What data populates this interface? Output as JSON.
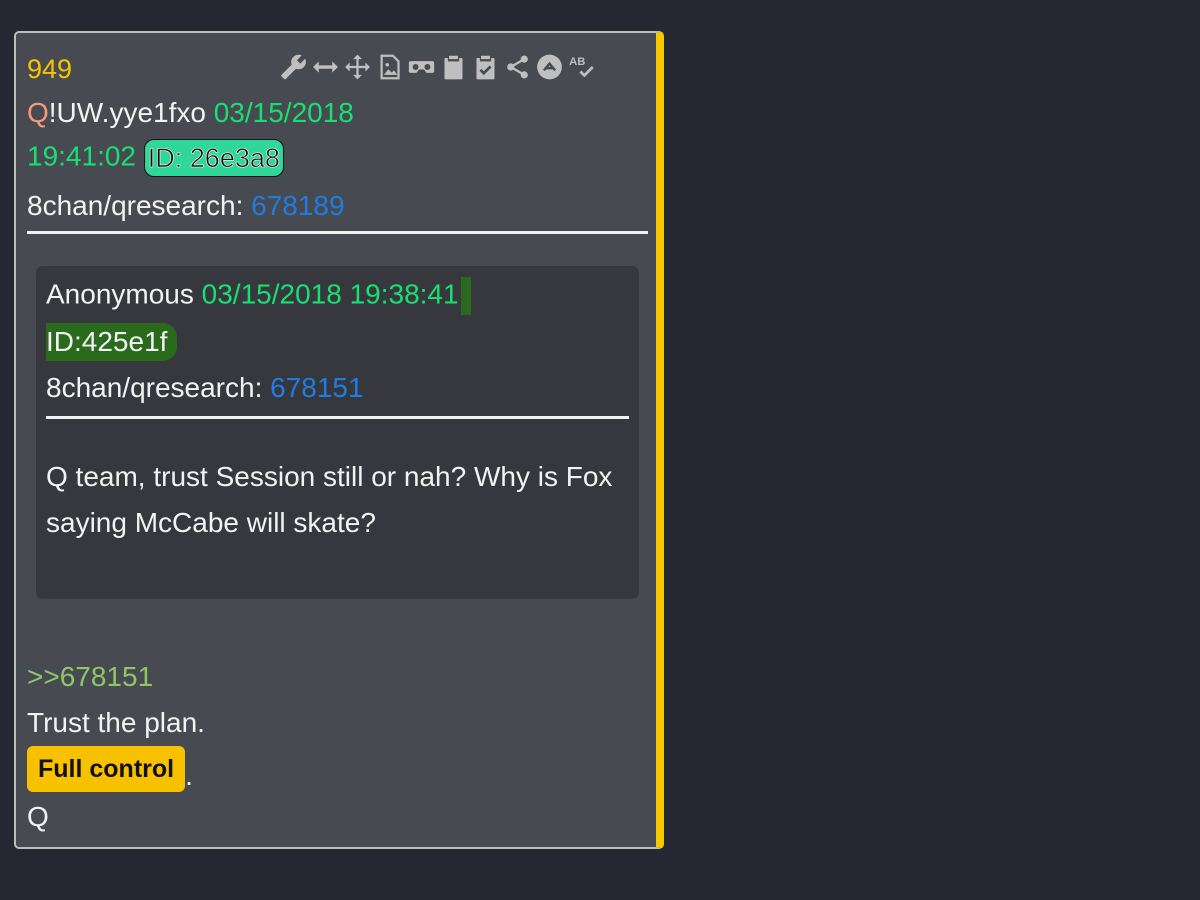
{
  "post": {
    "number": "949",
    "author": "Q",
    "tripcode": "!UW.yye1fxo",
    "date": "03/15/2018",
    "time": "19:41:02",
    "id": "ID: 26e3a8",
    "board": "8chan/qresearch:",
    "post_id": "678189"
  },
  "toolbar": {
    "icons": [
      "wrench-icon",
      "resize-horizontal-icon",
      "move-icon",
      "image-file-icon",
      "vr-goggles-icon",
      "clipboard-icon",
      "clipboard-check-icon",
      "share-icon",
      "arrow-up-circle-icon",
      "spellcheck-icon"
    ]
  },
  "quoted": {
    "author": "Anonymous",
    "datetime": "03/15/2018 19:38:41",
    "id": "ID:425e1f",
    "board": "8chan/qresearch:",
    "post_id": "678151",
    "text": "Q team, trust Session still or nah? Why is Fox saying McCabe will skate?"
  },
  "reply": {
    "link": ">>678151",
    "line1": "Trust the plan.",
    "highlight": "Full control",
    "after_highlight": ".",
    "signature": "Q"
  },
  "colors": {
    "background": "#252833",
    "card": "#484a52",
    "accent": "#f7c900",
    "green": "#18e070",
    "blue": "#1f7ce0",
    "author": "#f49a78",
    "reply_link": "#8fc765"
  }
}
